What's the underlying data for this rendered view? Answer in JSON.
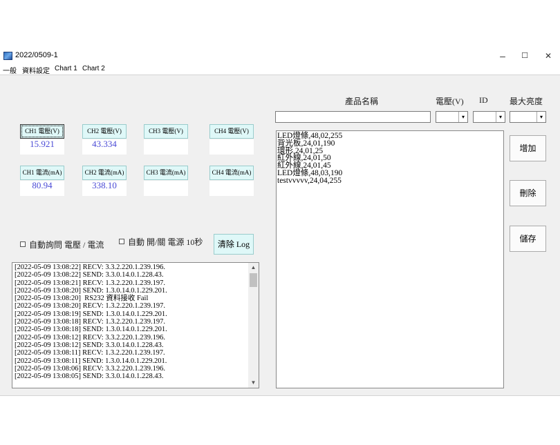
{
  "window": {
    "title": "2022/0509-1",
    "minimize": "–",
    "maximize": "☐",
    "close": "✕"
  },
  "menu": [
    "一般",
    "資料設定",
    "Chart 1",
    "Chart 2"
  ],
  "product_form": {
    "name_header": "產品名稱",
    "voltage_header": "電壓(V)",
    "id_header": "ID",
    "brightness_header": "最大亮度",
    "name_value": "",
    "voltage_value": "",
    "id_value": "",
    "brightness_value": ""
  },
  "voltage_channels": [
    {
      "label": "CH1 電壓(V)",
      "value": "15.921"
    },
    {
      "label": "CH2 電壓(V)",
      "value": "43.334"
    },
    {
      "label": "CH3 電壓(V)",
      "value": ""
    },
    {
      "label": "CH4 電壓(V)",
      "value": ""
    }
  ],
  "current_channels": [
    {
      "label": "CH1 電流(mA)",
      "value": "80.94"
    },
    {
      "label": "CH2 電流(mA)",
      "value": "338.10"
    },
    {
      "label": "CH3 電流(mA)",
      "value": ""
    },
    {
      "label": "CH4 電流(mA)",
      "value": ""
    }
  ],
  "options": {
    "auto_query_label": "自動詢問 電壓 / 電流",
    "auto_power_label": "自動 開/關 電源 10秒",
    "clear_log_label": "清除 Log"
  },
  "log_lines": [
    "[2022-05-09 13:08:22] RECV: 3.3.2.220.1.239.196.",
    "[2022-05-09 13:08:22] SEND: 3.3.0.14.0.1.228.43.",
    "[2022-05-09 13:08:21] RECV: 1.3.2.220.1.239.197.",
    "[2022-05-09 13:08:20] SEND: 1.3.0.14.0.1.229.201.",
    "[2022-05-09 13:08:20]  RS232 資料接收 Fail",
    "[2022-05-09 13:08:20] RECV: 1.3.2.220.1.239.197.",
    "[2022-05-09 13:08:19] SEND: 1.3.0.14.0.1.229.201.",
    "[2022-05-09 13:08:18] RECV: 1.3.2.220.1.239.197.",
    "[2022-05-09 13:08:18] SEND: 1.3.0.14.0.1.229.201.",
    "[2022-05-09 13:08:12] RECV: 3.3.2.220.1.239.196.",
    "[2022-05-09 13:08:12] SEND: 3.3.0.14.0.1.228.43.",
    "[2022-05-09 13:08:11] RECV: 1.3.2.220.1.239.197.",
    "[2022-05-09 13:08:11] SEND: 1.3.0.14.0.1.229.201.",
    "[2022-05-09 13:08:06] RECV: 3.3.2.220.1.239.196.",
    "[2022-05-09 13:08:05] SEND: 3.3.0.14.0.1.228.43."
  ],
  "product_list": [
    "LED燈條,48,02,255",
    "背光板,24,01,190",
    "環形,24,01,25",
    "紅外線,24,01,50",
    "紅外線,24,01,45",
    "LED燈條,48,03,190",
    "testvvvvv,24,04,255"
  ],
  "side_buttons": {
    "add": "增加",
    "delete": "刪除",
    "save": "儲存"
  },
  "icons": {
    "dropdown": "▾",
    "scroll_up": "▲",
    "scroll_down": "▼"
  }
}
